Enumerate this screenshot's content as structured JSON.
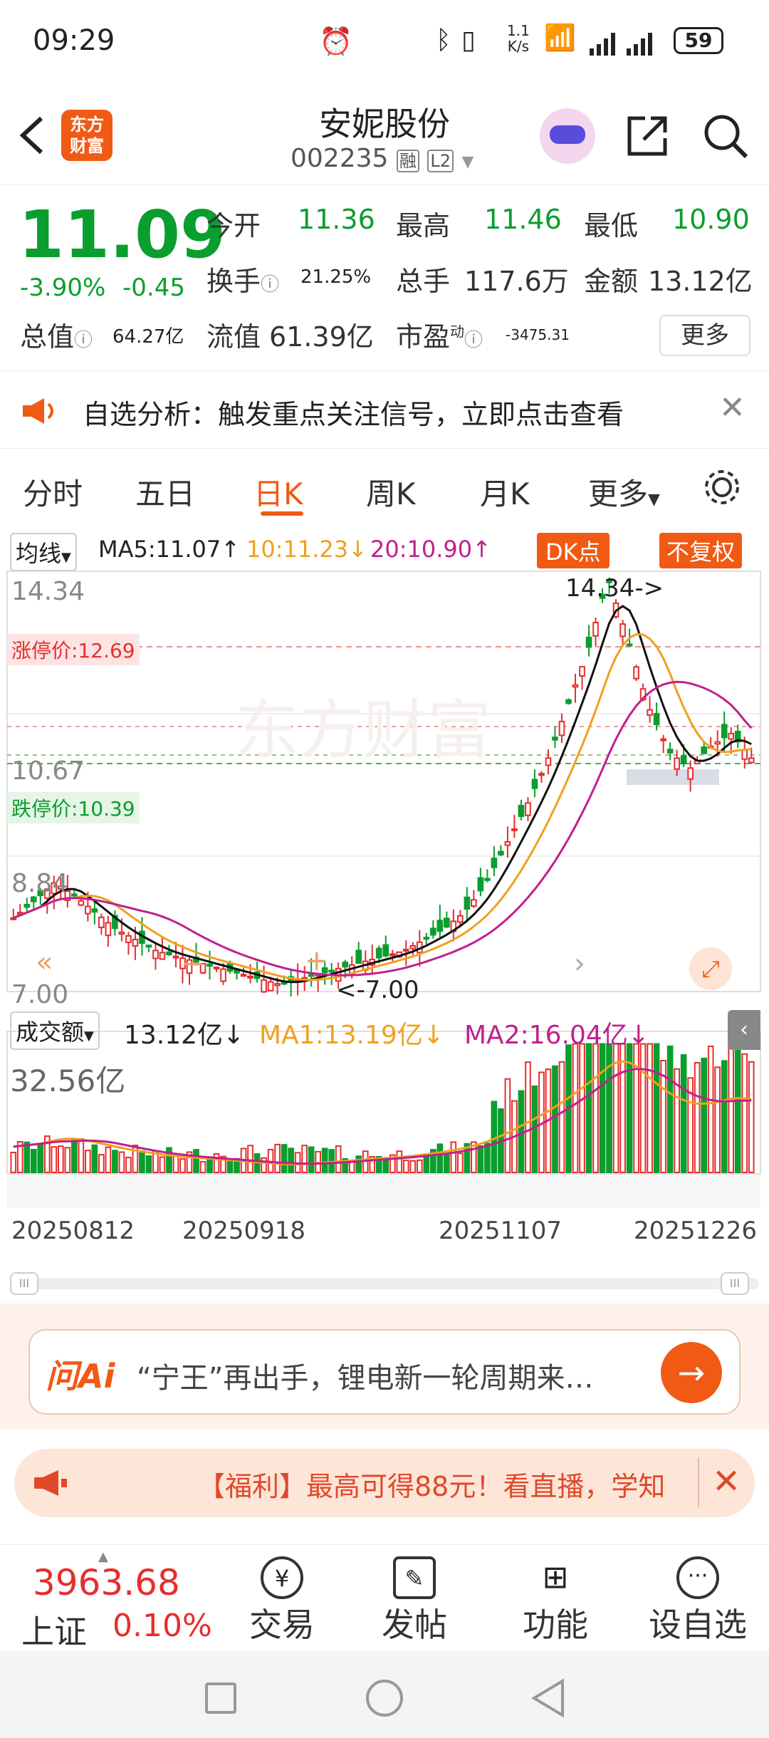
{
  "status_bar": {
    "time": "09:29",
    "net_speed_top": "1.1",
    "net_speed_unit": "K/s",
    "battery": "59",
    "icons": [
      "alarm-icon",
      "bluetooth-icon",
      "vibrate-icon",
      "wifi-6-icon",
      "signal-icon",
      "signal-icon",
      "battery-icon"
    ]
  },
  "header": {
    "logo_line1": "东方",
    "logo_line2": "财富",
    "title": "安妮股份",
    "code": "002235",
    "badge_rong": "融",
    "badge_level": "L2"
  },
  "quote": {
    "price": "11.09",
    "change_pct": "-3.90%",
    "change": "-0.45",
    "open_label": "今开",
    "open": "11.36",
    "high_label": "最高",
    "high": "11.46",
    "low_label": "最低",
    "low": "10.90",
    "turnover_label": "换手",
    "turnover": "21.25%",
    "volume_label": "总手",
    "volume": "117.6万",
    "amount_label": "金额",
    "amount": "13.12亿",
    "mktcap_label": "总值",
    "mktcap": "64.27亿",
    "float_label": "流值",
    "float": "61.39亿",
    "pe_label": "市盈",
    "pe_sup": "动",
    "pe": "-3475.31",
    "more": "更多"
  },
  "notice": {
    "text": "自选分析：触发重点关注信号，立即点击查看"
  },
  "tabs": [
    "分时",
    "五日",
    "日K",
    "周K",
    "月K",
    "更多"
  ],
  "chart_info": {
    "ma_selector": "均线",
    "ma5": "MA5:11.07↑",
    "ma10": "10:11.23↓",
    "ma20": "20:10.90↑",
    "dk_btn": "DK点",
    "fq_btn": "不复权",
    "limit_up": "涨停价:12.69",
    "limit_down": "跌停价:10.39",
    "y_top": "14.34",
    "y_mid": "10.67",
    "y_low1": "8.84",
    "y_low2": "7.00",
    "max_label": "14.34->",
    "min_label": "<-7.00",
    "vol_selector": "成交额",
    "vol_val": "13.12亿↓",
    "vol_ma1": "MA1:13.19亿↓",
    "vol_ma2": "MA2:16.04亿↓",
    "vol_top": "32.56亿",
    "dates": [
      "20250812",
      "20250918",
      "20251107",
      "20251226"
    ]
  },
  "chart_data": {
    "type": "candlestick",
    "x": [
      "20250812",
      "20250918",
      "20251107",
      "20251226"
    ],
    "ylim": [
      7.0,
      14.34
    ],
    "close_trend": [
      8.2,
      8.5,
      8.84,
      8.6,
      8.3,
      8.0,
      7.8,
      7.6,
      7.5,
      7.4,
      7.3,
      7.2,
      7.1,
      7.0,
      7.1,
      7.2,
      7.3,
      7.4,
      7.5,
      7.6,
      7.8,
      8.0,
      8.3,
      8.8,
      9.5,
      10.2,
      11.0,
      12.0,
      13.0,
      14.34,
      13.2,
      12.0,
      11.2,
      10.9,
      11.3,
      11.54,
      11.09
    ],
    "volume_max": "32.56亿"
  },
  "ai": {
    "logo": "问Ai",
    "text": "“宁王”再出手，锂电新一轮周期来…"
  },
  "promo": {
    "text": "【福利】最高可得88元！看直播，学知"
  },
  "bottom": {
    "index_value": "3963.68",
    "index_name": "上证",
    "index_change": "0.10%",
    "nav": [
      "交易",
      "发帖",
      "功能",
      "设自选"
    ]
  }
}
